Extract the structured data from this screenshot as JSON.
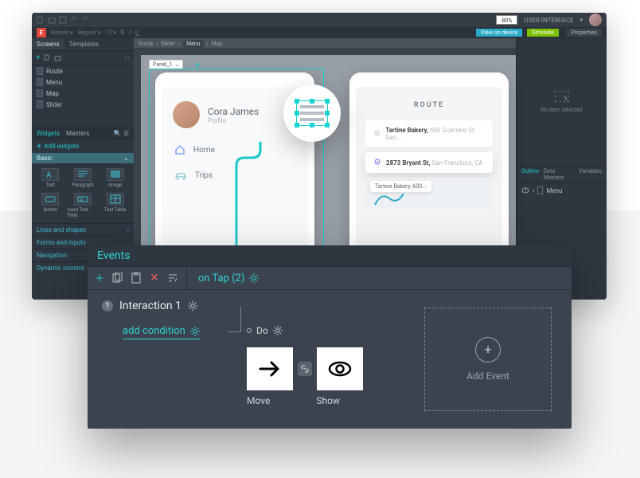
{
  "titlebar": {
    "zoom": "80%",
    "user_label": "USER INTERFACE"
  },
  "toolbar": {
    "view": "View on device",
    "simulate": "Simulate",
    "properties": "Properties"
  },
  "breadcrumb": {
    "a": "Route",
    "b": "Slider",
    "c": "Menu",
    "d": "Map"
  },
  "left": {
    "tabs": {
      "screens": "Screens",
      "templates": "Templates"
    },
    "tree": [
      "Route",
      "Menu",
      "Map",
      "Slider"
    ],
    "widgets_tabs": {
      "widgets": "Widgets",
      "masters": "Masters"
    },
    "add_widgets": "Add widgets",
    "basic": "Basic",
    "cells": {
      "text": "Text",
      "paragraph": "Paragraph",
      "image": "Image",
      "button": "Button",
      "input": "Input Text Field",
      "table": "Text Table"
    },
    "cats": {
      "lines": "Lines and shapes",
      "forms": "Forms and inputs",
      "nav": "Navigation",
      "dyn": "Dynamic content"
    }
  },
  "canvas": {
    "panel_name": "Panel_1",
    "profile": {
      "name": "Cora James",
      "role": "Profile"
    },
    "menu_home": "Home",
    "menu_trips": "Trips",
    "route_title": "ROUTE",
    "addr1": {
      "name": "Tartine Bakery,",
      "rest": "600 Guerrero St, San..."
    },
    "addr2": {
      "name": "2873 Bryant St,",
      "rest": "San Francisco, CA"
    },
    "map_chip": "Tartine Bakery, 600..."
  },
  "right": {
    "no_item": "No item selected",
    "tabs": {
      "outline": "Outline",
      "dm": "Data Masters",
      "vars": "Variables"
    },
    "outline_item": "Menu"
  },
  "events": {
    "title": "Events",
    "tab": "on Tap (2)",
    "interaction": "Interaction 1",
    "add_condition": "add condition",
    "do": "Do",
    "move": "Move",
    "show": "Show",
    "add_event": "Add Event"
  }
}
